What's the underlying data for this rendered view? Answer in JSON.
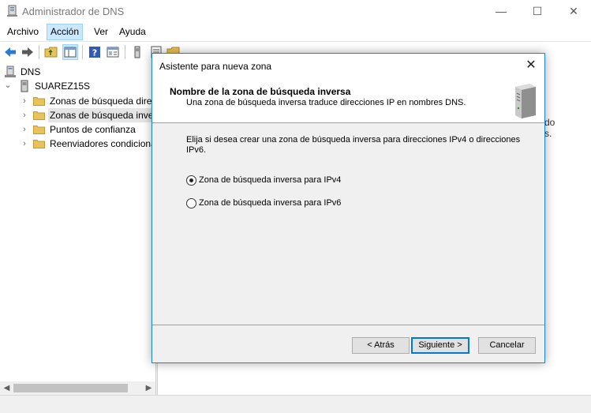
{
  "window": {
    "title": "Administrador de DNS",
    "minimize_glyph": "—",
    "maximize_glyph": "☐",
    "close_glyph": "✕"
  },
  "menu": {
    "items": [
      "Archivo",
      "Acción",
      "Ver",
      "Ayuda"
    ],
    "active": "Acción"
  },
  "toolbar": {
    "icons": [
      "back-icon",
      "forward-icon",
      "up-folder-icon",
      "show-hide-tree-icon",
      "help-icon",
      "properties-icon",
      "server-icon",
      "list-icon",
      "folder-icon"
    ]
  },
  "tree": {
    "root": "DNS",
    "server": "SUAREZ15S",
    "items": [
      {
        "label": "Zonas de búsqueda directa",
        "selected": false
      },
      {
        "label": "Zonas de búsqueda inversa",
        "selected": true
      },
      {
        "label": "Puntos de confianza",
        "selected": false
      },
      {
        "label": "Reenviadores condicionales",
        "selected": false
      }
    ],
    "expand_glyph": "›",
    "collapse_glyph": "⌄"
  },
  "right_pane": {
    "fragment_1": "do",
    "fragment_2": "s."
  },
  "dialog": {
    "title": "Asistente para nueva zona",
    "close_glyph": "✕",
    "heading": "Nombre de la zona de búsqueda inversa",
    "subheading": "Una zona de búsqueda inversa traduce direcciones IP en nombres DNS.",
    "description": "Elija si desea crear una zona de búsqueda inversa para direcciones IPv4 o direcciones IPv6.",
    "options": [
      {
        "label": "Zona de búsqueda inversa para IPv4",
        "checked": true
      },
      {
        "label": "Zona de búsqueda inversa para IPv6",
        "checked": false
      }
    ],
    "buttons": {
      "back": "< Atrás",
      "next": "Siguiente >",
      "cancel": "Cancelar"
    }
  },
  "colors": {
    "accent": "#0078d7",
    "selection": "#cce8ff",
    "folder": "#e8c25a"
  }
}
